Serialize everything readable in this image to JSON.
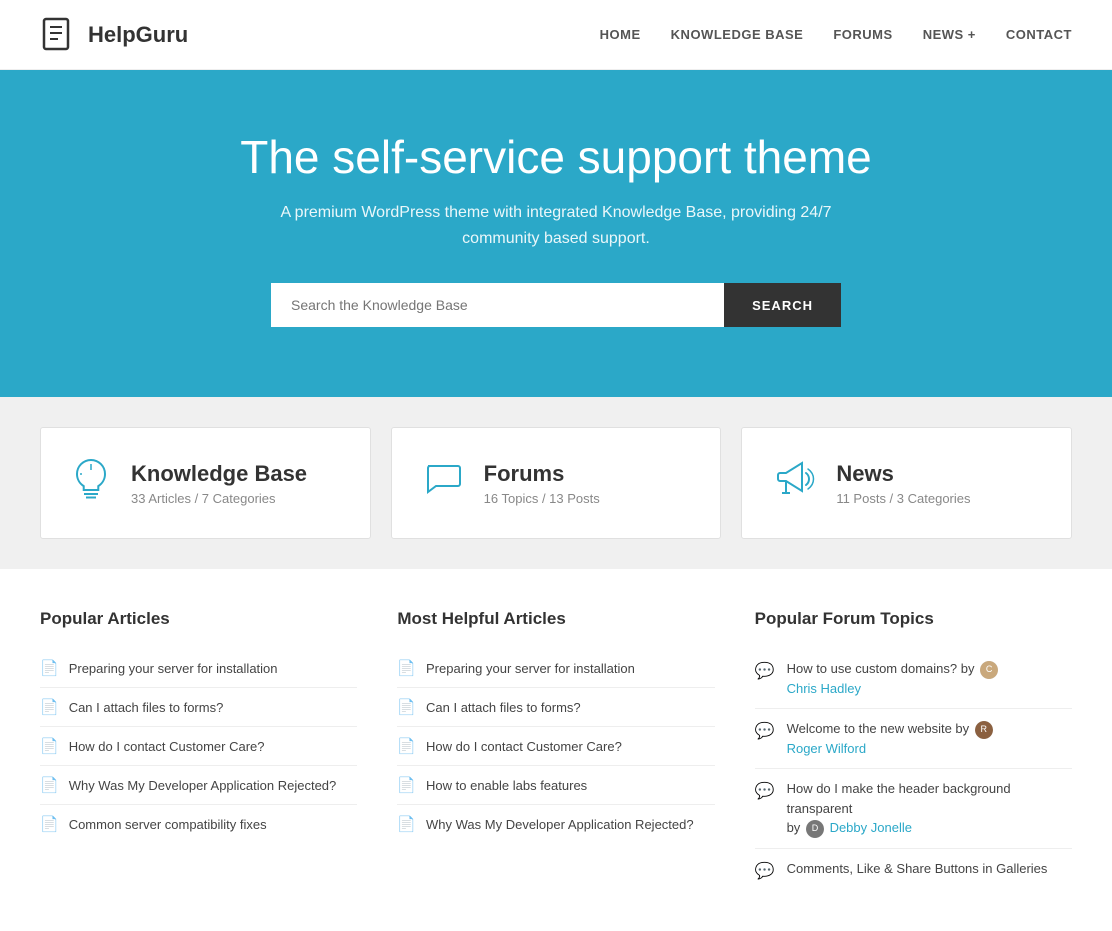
{
  "header": {
    "logo_text": "HelpGuru",
    "nav_items": [
      {
        "label": "HOME",
        "id": "home"
      },
      {
        "label": "KNOWLEDGE BASE",
        "id": "knowledge-base"
      },
      {
        "label": "FORUMS",
        "id": "forums"
      },
      {
        "label": "NEWS +",
        "id": "news"
      },
      {
        "label": "CONTACT",
        "id": "contact"
      }
    ]
  },
  "hero": {
    "title": "The self-service support theme",
    "subtitle": "A premium WordPress theme with integrated Knowledge Base, providing 24/7 community based support.",
    "search_placeholder": "Search the Knowledge Base",
    "search_button": "SEARCH"
  },
  "stats": [
    {
      "id": "knowledge-base",
      "title": "Knowledge Base",
      "detail": "33 Articles / 7 Categories",
      "icon": "lightbulb"
    },
    {
      "id": "forums",
      "title": "Forums",
      "detail": "16 Topics / 13 Posts",
      "icon": "chat"
    },
    {
      "id": "news",
      "title": "News",
      "detail": "11 Posts / 3 Categories",
      "icon": "megaphone"
    }
  ],
  "popular_articles": {
    "heading": "Popular Articles",
    "items": [
      "Preparing your server for installation",
      "Can I attach files to forms?",
      "How do I contact Customer Care?",
      "Why Was My Developer Application Rejected?",
      "Common server compatibility fixes"
    ]
  },
  "helpful_articles": {
    "heading": "Most Helpful Articles",
    "items": [
      "Preparing your server for installation",
      "Can I attach files to forms?",
      "How do I contact Customer Care?",
      "How to enable labs features",
      "Why Was My Developer Application Rejected?"
    ]
  },
  "forum_topics": {
    "heading": "Popular Forum Topics",
    "items": [
      {
        "text": "How to use custom domains? by",
        "author": "Chris Hadley",
        "has_avatar": true,
        "avatar_color": "#c9a87c"
      },
      {
        "text": "Welcome to the new website by",
        "author": "Roger Wilford",
        "has_avatar": true,
        "avatar_color": "#8b6040"
      },
      {
        "text": "How do I make the header background transparent",
        "by_text": "by",
        "author": "Debby Jonelle",
        "has_avatar": true,
        "avatar_color": "#555"
      },
      {
        "text": "Comments, Like & Share Buttons in Galleries",
        "author": "",
        "has_avatar": false,
        "avatar_color": ""
      }
    ]
  }
}
